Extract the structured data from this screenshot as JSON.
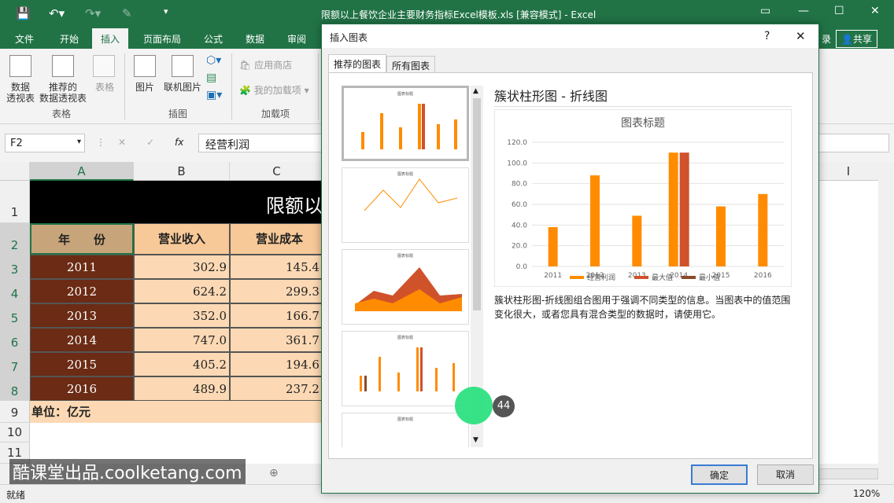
{
  "window": {
    "title": "限额以上餐饮企业主要财务指标Excel模板.xls  [兼容模式] - Excel"
  },
  "ribbon_tabs": [
    "文件",
    "开始",
    "插入",
    "页面布局",
    "公式",
    "数据",
    "审阅"
  ],
  "ribbon_right": {
    "login": "录",
    "share": "共享"
  },
  "ribbon": {
    "pivot": "数据\n透视表",
    "recommend": "推荐的\n数据透视表",
    "table": "表格",
    "picture": "图片",
    "online_picture": "联机图片",
    "app_store": "应用商店",
    "my_addins": "我的加载项",
    "groups": [
      "表格",
      "插图",
      "加载项"
    ]
  },
  "formula": {
    "name_box": "F2",
    "fx": "fx",
    "value": "经营利润"
  },
  "columns": [
    "A",
    "B",
    "C",
    "I"
  ],
  "rows": [
    "1",
    "2",
    "3",
    "4",
    "5",
    "6",
    "7",
    "8",
    "9",
    "10",
    "11"
  ],
  "sheet": {
    "title": "限额以",
    "headers": [
      "年　　份",
      "营业收入",
      "营业成本"
    ],
    "years": [
      "2011",
      "2012",
      "2013",
      "2014",
      "2015",
      "2016"
    ],
    "revenue": [
      "302.9",
      "624.2",
      "352.0",
      "747.0",
      "405.2",
      "489.9"
    ],
    "cost": [
      "145.4",
      "299.3",
      "166.7",
      "361.7",
      "194.6",
      "237.2"
    ],
    "unit": "单位：亿元"
  },
  "statusbar": {
    "ready": "就绪",
    "zoom": "120%"
  },
  "watermark": "酷课堂出品.coolketang.com",
  "badge": "44",
  "dialog": {
    "title": "插入图表",
    "help": "?",
    "close": "✕",
    "tabs": [
      "推荐的图表",
      "所有图表"
    ],
    "thumb_title": "图表标题",
    "chart_name": "簇状柱形图 - 折线图",
    "description": "簇状柱形图-折线图组合图用于强调不同类型的信息。当图表中的值范围变化很大，或者您具有混合类型的数据时，请使用它。",
    "ok": "确定",
    "cancel": "取消"
  },
  "colors": {
    "excel_green": "#217346",
    "orange": "#ff8c00",
    "darkorange": "#d0522b",
    "brown": "#8b4a2b"
  },
  "chart_data": {
    "type": "bar",
    "title": "图表标题",
    "categories": [
      "2011",
      "2012",
      "2013",
      "2014",
      "2015",
      "2016"
    ],
    "series": [
      {
        "name": "经营利润",
        "values": [
          38,
          88,
          49,
          110,
          58,
          70
        ],
        "color": "#ff8c00"
      },
      {
        "name": "最大值",
        "values": [
          null,
          null,
          null,
          110,
          null,
          null
        ],
        "color": "#d0522b"
      },
      {
        "name": "最小值",
        "values": [
          null,
          null,
          null,
          null,
          null,
          null
        ],
        "color": "#8b4a2b"
      }
    ],
    "yticks": [
      "0.0",
      "20.0",
      "40.0",
      "60.0",
      "80.0",
      "100.0",
      "120.0"
    ],
    "ylim": [
      0,
      120
    ],
    "legend": "bottom"
  }
}
